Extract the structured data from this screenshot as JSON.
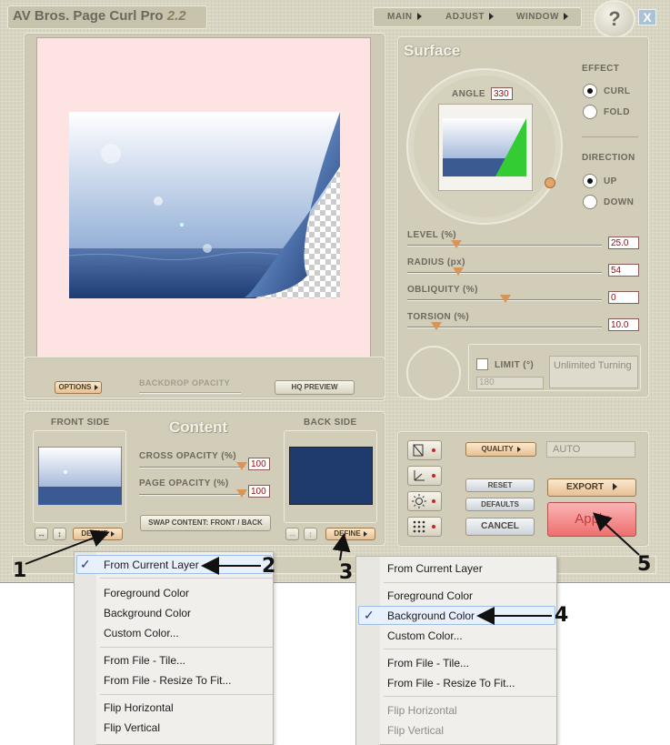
{
  "app": {
    "title": "AV Bros. Page Curl Pro",
    "version": "2.2",
    "menu": [
      "MAIN",
      "ADJUST",
      "WINDOW"
    ],
    "help_glyph": "?",
    "close_glyph": "X"
  },
  "preview": {
    "options_label": "OPTIONS",
    "backdrop_opacity_label": "BACKDROP OPACITY",
    "hq_preview_label": "HQ PREVIEW"
  },
  "surface": {
    "title": "Surface",
    "angle_label": "ANGLE",
    "angle_value": "330",
    "effect_label": "EFFECT",
    "effect_options": [
      "CURL",
      "FOLD"
    ],
    "effect_selected": "CURL",
    "direction_label": "DIRECTION",
    "direction_options": [
      "UP",
      "DOWN"
    ],
    "direction_selected": "UP",
    "sliders": [
      {
        "label": "LEVEL (%)",
        "value": "25.0",
        "fraction": 0.25
      },
      {
        "label": "RADIUS (px)",
        "value": "54",
        "fraction": 0.26
      },
      {
        "label": "OBLIQUITY (%)",
        "value": "0",
        "fraction": 0.5
      },
      {
        "label": "TORSION (%)",
        "value": "10.0",
        "fraction": 0.14
      }
    ],
    "limit_label": "LIMIT (°)",
    "limit_value": "180",
    "turning_text": "Unlimited Turning"
  },
  "content": {
    "title": "Content",
    "front_side_label": "FRONT SIDE",
    "back_side_label": "BACK SIDE",
    "cross_opacity_label": "CROSS OPACITY (%)",
    "cross_opacity_value": "100",
    "page_opacity_label": "PAGE OPACITY (%)",
    "page_opacity_value": "100",
    "swap_label": "SWAP CONTENT: FRONT / BACK",
    "define_label": "DEFINE",
    "back_color": "#1f3a6c"
  },
  "render": {
    "quality_label": "QUALITY",
    "quality_value": "AUTO",
    "reset_label": "RESET",
    "defaults_label": "DEFAULTS",
    "cancel_label": "CANCEL",
    "export_label": "EXPORT",
    "apply_label": "Apply"
  },
  "menu_left": {
    "groups": [
      [
        "From Current Layer"
      ],
      [
        "Foreground Color",
        "Background Color",
        "Custom Color..."
      ],
      [
        "From File - Tile...",
        "From File - Resize To Fit..."
      ],
      [
        "Flip Horizontal",
        "Flip Vertical"
      ]
    ],
    "checked": "From Current Layer"
  },
  "menu_right": {
    "groups": [
      [
        "From Current Layer"
      ],
      [
        "Foreground Color",
        "Background Color",
        "Custom Color..."
      ],
      [
        "From File - Tile...",
        "From File - Resize To Fit..."
      ],
      [
        "Flip Horizontal",
        "Flip Vertical"
      ]
    ],
    "checked": "Background Color",
    "disabled": [
      "Flip Horizontal",
      "Flip Vertical"
    ]
  },
  "callouts": [
    "1",
    "2",
    "3",
    "4",
    "5"
  ],
  "colors": {
    "accent_orange": "#d7955a",
    "apply_red": "#f47b7b",
    "preview_bg": "#fde3e1",
    "menu_check": "#1c3a87"
  }
}
